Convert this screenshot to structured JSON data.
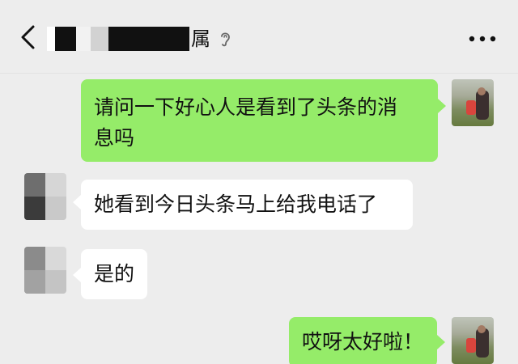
{
  "header": {
    "title_suffix": "属",
    "back_icon": "chevron-left-icon",
    "more_icon": "more-dots-icon",
    "ear_icon": "ear-icon"
  },
  "messages": [
    {
      "side": "out",
      "text_line1": "请问一下好心人是看到了头条的消",
      "text_line2": "息吗"
    },
    {
      "side": "in",
      "text": "她看到今日头条马上给我电话了"
    },
    {
      "side": "in",
      "text": "是的"
    },
    {
      "side": "out",
      "text": "哎呀太好啦！"
    }
  ],
  "colors": {
    "background": "#ededed",
    "outgoing_bubble": "#95ec69",
    "incoming_bubble": "#ffffff"
  }
}
